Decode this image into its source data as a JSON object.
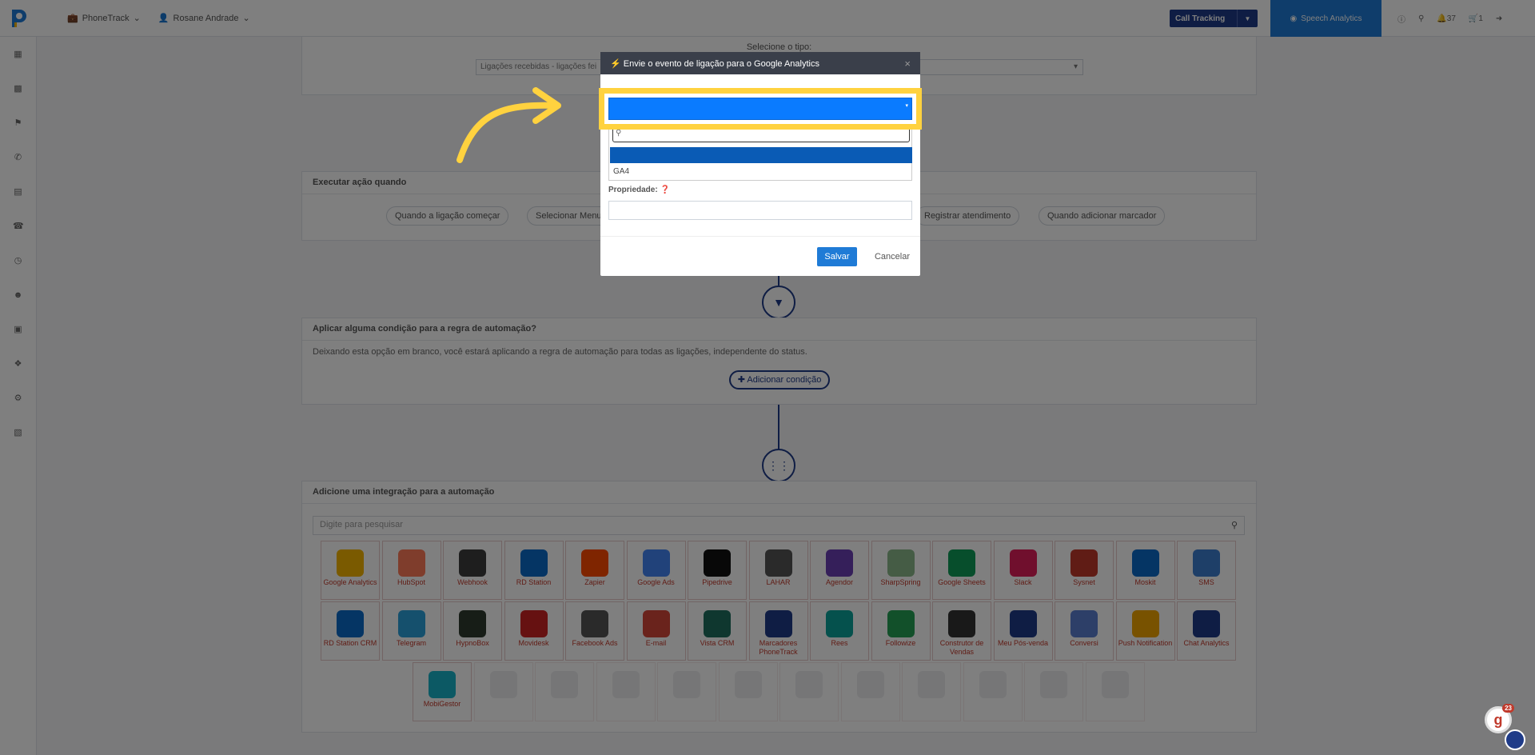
{
  "topbar": {
    "product": "PhoneTrack",
    "user": "Rosane Andrade",
    "call_tracking": "Call Tracking",
    "speech_analytics": "Speech Analytics",
    "notif_count": "37",
    "cart_count": "1"
  },
  "type_section": {
    "label": "Selecione o tipo:",
    "select_value": "Ligações recebidas - ligações fei"
  },
  "trigger": {
    "title": "Executar ação quando",
    "pills": [
      "Quando a ligação começar",
      "Selecionar Menu",
      "Registrar atendimento",
      "Quando adicionar marcador"
    ]
  },
  "condition": {
    "title": "Aplicar alguma condição para a regra de automação?",
    "text": "Deixando esta opção em branco, você estará aplicando a regra de automação para todas as ligações, independente do status.",
    "add_button": "Adicionar condição"
  },
  "integration": {
    "title": "Adicione uma integração para a automação",
    "search_placeholder": "Digite para pesquisar",
    "row1": [
      "Google Analytics",
      "HubSpot",
      "Webhook",
      "RD Station",
      "Zapier",
      "Google Ads",
      "Pipedrive",
      "LAHAR",
      "Agendor",
      "SharpSpring",
      "Google Sheets",
      "Slack",
      "Sysnet",
      "Moskit",
      "SMS"
    ],
    "row2": [
      "RD Station CRM",
      "Telegram",
      "HypnoBox",
      "Movidesk",
      "Facebook Ads",
      "E-mail",
      "Vista CRM",
      "Marcadores PhoneTrack",
      "Rees",
      "Followize",
      "Construtor de Vendas",
      "Meu Pós-venda",
      "Conversi",
      "Push Notification",
      "Chat Analytics"
    ],
    "row3": [
      "MobiGestor"
    ],
    "row1_colors": [
      "#f4b400",
      "#ff7a59",
      "#3d3d3d",
      "#0b6ac9",
      "#ff4a00",
      "#4285f4",
      "#111111",
      "#555555",
      "#6a3fb5",
      "#8ab98a",
      "#0f9d58",
      "#e01e5a",
      "#c0392b",
      "#0b6ac9",
      "#3d7fd1"
    ],
    "row2_colors": [
      "#0b6ac9",
      "#2aa1da",
      "#2e3a2e",
      "#cc2222",
      "#555555",
      "#d44638",
      "#1f6f5f",
      "#1f3b88",
      "#0aa39a",
      "#24a055",
      "#333333",
      "#1f3b88",
      "#5b7fd0",
      "#f0a500",
      "#1f3b88"
    ],
    "row3_colors": [
      "#19b3c8"
    ]
  },
  "modal": {
    "title": "Envie o evento de ligação para o Google Analytics",
    "close": "×",
    "property_label": "Propriedade:",
    "save": "Salvar",
    "cancel": "Cancelar",
    "dropdown_option": "GA4"
  },
  "chat_badge": "23",
  "colors": {
    "brand": "#1f3b88",
    "accent": "#1f7bd6",
    "highlight": "#ffd23f"
  }
}
